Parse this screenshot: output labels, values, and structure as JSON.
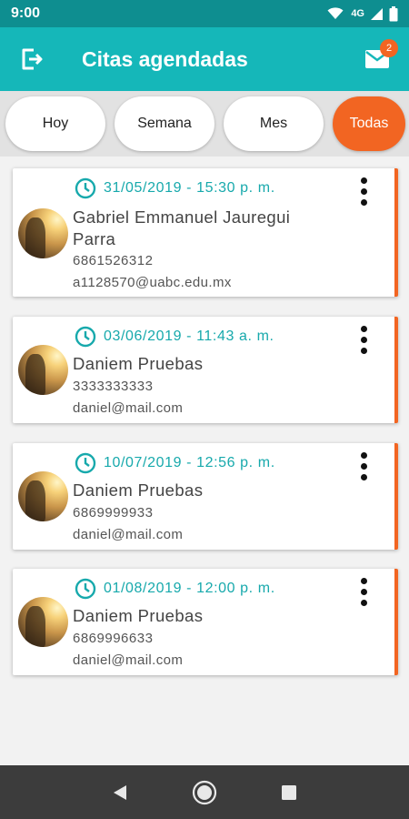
{
  "status_bar": {
    "time": "9:00",
    "network": "4G"
  },
  "app_bar": {
    "title": "Citas agendadas",
    "mail_count": "2"
  },
  "filters": [
    {
      "label": "Hoy",
      "active": false
    },
    {
      "label": "Semana",
      "active": false
    },
    {
      "label": "Mes",
      "active": false
    },
    {
      "label": "Todas",
      "active": true
    }
  ],
  "appointments": [
    {
      "datetime": "31/05/2019 - 15:30 p. m.",
      "name": "Gabriel Emmanuel Jauregui Parra",
      "phone": "6861526312",
      "email": "a1128570@uabc.edu.mx"
    },
    {
      "datetime": "03/06/2019 - 11:43 a. m.",
      "name": "Daniem Pruebas",
      "phone": "3333333333",
      "email": "daniel@mail.com"
    },
    {
      "datetime": "10/07/2019 - 12:56 p. m.",
      "name": "Daniem Pruebas",
      "phone": "6869999933",
      "email": "daniel@mail.com"
    },
    {
      "datetime": "01/08/2019 - 12:00 p. m.",
      "name": "Daniem Pruebas",
      "phone": "6869996633",
      "email": "daniel@mail.com"
    }
  ],
  "icons": {
    "status": [
      "wifi-icon",
      "signal-icon",
      "battery-icon"
    ],
    "app_bar": [
      "logout-icon",
      "mail-icon"
    ],
    "card": [
      "clock-icon",
      "more-vert-icon"
    ],
    "nav": [
      "back-icon",
      "home-icon",
      "recents-icon"
    ]
  },
  "colors": {
    "primary": "#15b7b9",
    "primary_dark": "#0e8e90",
    "accent": "#f26522",
    "date_text": "#17a9ac"
  }
}
